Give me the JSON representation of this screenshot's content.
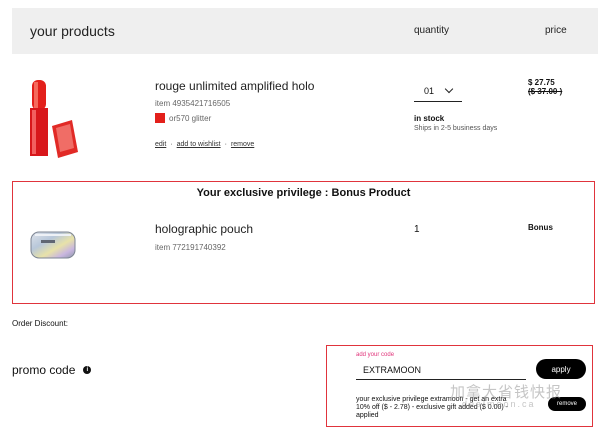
{
  "header": {
    "title": "your products",
    "quantity_label": "quantity",
    "price_label": "price"
  },
  "product": {
    "name": "rouge unlimited amplified holo",
    "item": "item 4935421716505",
    "shade": "or570 glitter",
    "shade_color": "#e3201b",
    "actions": {
      "edit": "edit",
      "sep1": "·",
      "wishlist": "add to wishlist",
      "sep2": "·",
      "remove": "remove"
    },
    "quantity": "01",
    "stock": "in stock",
    "shipping": "Ships in 2-5 business days",
    "price": "$ 27.75",
    "original_price": "($ 37.00 )"
  },
  "bonus": {
    "title": "Your exclusive privilege : Bonus Product",
    "name": "holographic pouch",
    "item": "item 772191740392",
    "quantity": "1",
    "price": "Bonus"
  },
  "order_discount_label": "Order Discount:",
  "promo": {
    "label": "promo code",
    "info_icon": "i",
    "caption": "add your code",
    "code": "EXTRAMOON",
    "apply_label": "apply",
    "message": "your exclusive privilege extramoon - get an extra 10% off ($ - 2.78) - exclusive gift added ($ 0.00) - applied",
    "remove_label": "remove"
  },
  "watermark": {
    "text": "加拿大省钱快报",
    "sub": "dealmoon.ca"
  },
  "colors": {
    "accent_border": "#e0343c",
    "caption_pink": "#e0347a",
    "header_bg": "#efefef"
  }
}
